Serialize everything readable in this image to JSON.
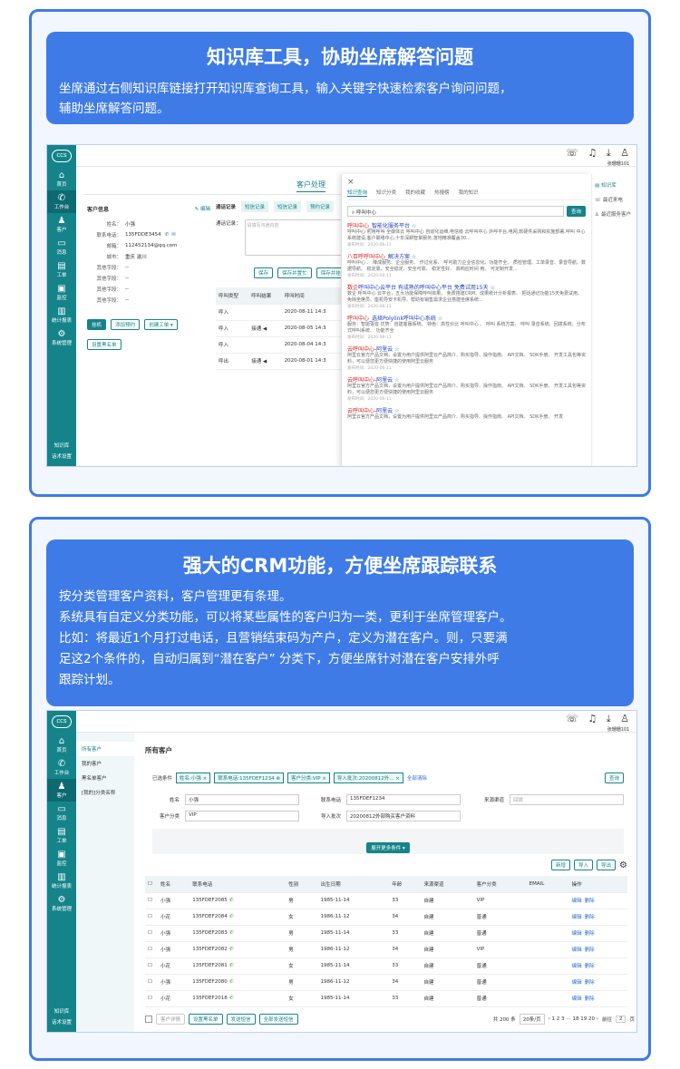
{
  "section1": {
    "title": "知识库工具，协助坐席解答问题",
    "desc_line1": "坐席通过右侧知识库链接打开知识库查询工具，输入关键字快速检索客户询问问题，",
    "desc_line2": "辅助坐席解答问题。",
    "app": {
      "logo": "ccs",
      "nav": [
        {
          "label": "首页",
          "icon": "⌂"
        },
        {
          "label": "工作台",
          "icon": "✆"
        },
        {
          "label": "客户",
          "icon": "♟"
        },
        {
          "label": "消息",
          "icon": "▭"
        },
        {
          "label": "工单",
          "icon": "▤"
        },
        {
          "label": "监控",
          "icon": "▣"
        },
        {
          "label": "统计报表",
          "icon": "▥"
        },
        {
          "label": "系统管理",
          "icon": "⚙"
        }
      ],
      "nav_bottom": [
        "知识库",
        "话术设置"
      ],
      "user": "张珊珊101",
      "tabs": [
        "客户处理",
        "客"
      ],
      "customer": {
        "section_title": "客户信息",
        "edit": "编辑",
        "fields": [
          {
            "k": "姓名：",
            "v": "小强"
          },
          {
            "k": "联系电话：",
            "v": "135FDDE3454"
          },
          {
            "k": "邮箱：",
            "v": "112452134@qq.com"
          },
          {
            "k": "城市：",
            "v": "重庆 渝川"
          },
          {
            "k": "其他字段：",
            "v": "--"
          },
          {
            "k": "其他字段：",
            "v": "--"
          },
          {
            "k": "其他字段：",
            "v": "--"
          },
          {
            "k": "其他字段：",
            "v": "--"
          }
        ],
        "buttons": [
          "挂机",
          "添加预约",
          "创建工单 ▾",
          "设置黑名单"
        ]
      },
      "call": {
        "tabs": [
          "通话记录",
          "短信记录",
          "短信记录",
          "预约记录"
        ],
        "record_label": "通话记录：",
        "placeholder": "请填写沟通内容",
        "buttons": [
          "保存",
          "保存并置忙",
          "保存并挂机"
        ],
        "cols": [
          "呼叫类型",
          "呼叫结果",
          "呼叫时间"
        ],
        "rows": [
          {
            "type": "呼入",
            "result": "",
            "time": "2020-08-11  14:3"
          },
          {
            "type": "呼入",
            "result": "接通 ◀",
            "time": "2020-08-05  14:3"
          },
          {
            "type": "呼入",
            "result": "",
            "time": "2020-08-04  14:3"
          },
          {
            "type": "呼出",
            "result": "接通 ◀",
            "time": "2020-08-01  14:3"
          }
        ]
      },
      "kb": {
        "close": "×",
        "tabs": [
          "知识查询",
          "知识分类",
          "我的收藏",
          "热搜榜",
          "我的知识"
        ],
        "search_value": "呼叫中心",
        "search_btn": "查询",
        "articles": [
          {
            "title_a": "呼叫中心",
            "title_b": "_智能化服务平台",
            "desc": "呼叫中心 利用呼叫 全媒体云 呼叫中心 自动化运维,电信级 云呼叫中心 外呼平台,电网,软硬件采购和实施部署,呼叫 中心系统建设,客户联络中心,十年深耕智掌服务,落地精准覆盖30...",
            "date": "发布时间：2020-06-11"
          },
          {
            "title_a": "八百呼呼叫中心",
            "title_b": "_解决方案",
            "desc": "呼叫中心 、 降成服务、企业服务、 作过化系、 呼可助力企业信息化、功能齐全、 质检管理、工单录音、录音导航、数据导航、 稳定靠、安全稳定、安全可靠、 稳定性好、 高响应时间 用、 可定制开发...",
            "date": "发布时间：2020-06-11"
          },
          {
            "title_a": "数企",
            "title_b": "呼叫中心云平台 有成熟的呼叫中心平台 免费试用15天",
            "desc": "数企 呼叫中心 云平台，五大功能保障呼叫效果。 免费搭建CRM、成果统计分析报表、 把话通记功能15天免费试用、 免除坐席员、座机导安卡机导、帮助有销售需求企业搭建坐席系统...",
            "date": "发布时间：2020-06-11"
          },
          {
            "title_a": "呼叫中心",
            "title_b": "_选择Polylink呼叫中心系统",
            "desc": "服务：智能语音 优势：自建客服系统、 特色：高性价比 呼叫中心 、 呼叫 系统方案、 呼叫 录音系统、回拨系统、分布式呼叫系统、 功能齐全",
            "date": "发布时间：2020-06-11"
          },
          {
            "title_a": "云呼叫中心",
            "title_b": "-阿里云",
            "desc": "阿里云官方产品文档，设置为用户提供阿里云产品简介、购买指导、操作指南、 API文档、 SDK手册、 开发工具包等资料，可以便您更方便快捷的使用阿里云服务",
            "date": "发布时间：2020-06-11"
          },
          {
            "title_a": "云呼叫中心",
            "title_b": "-阿里云",
            "desc": "阿里云官方产品文档，设置为用户提供阿里云产品简介、购买指导、操作指南、 API文档、 SDK手册、 开发工具包等资料，可以便您更方便快捷的使用阿里云服务",
            "date": "发布时间：2020-06-11"
          },
          {
            "title_a": "云呼叫中心",
            "title_b": "-阿里云",
            "desc": "阿里云官方产品文档，设置为用户提供阿里云产品简介、购买指导、操作指南、 API文档、 SDK手册、 开发",
            "date": ""
          }
        ]
      },
      "right_links": [
        "知识库",
        "最近来电",
        "最近服务客户"
      ]
    }
  },
  "section2": {
    "title": "强大的CRM功能，方便坐席跟踪联系",
    "desc_lines": [
      "按分类管理客户资料，客户管理更有条理。",
      "系统具有自定义分类功能，可以将某些属性的客户归为一类，更利于坐席管理客户。",
      "比如：将最近1个月打过电话，且营销结束码为产户，定义为潜在客户。则，只要满",
      "足这2个条件的，自动归属到“潜在客户” 分类下，方便坐席针对潜在客户安排外呼",
      "跟踪计划。"
    ],
    "app": {
      "user": "张珊珊101",
      "subnav": [
        "所有客户",
        "我的客户",
        "黑名单客户",
        "[我的]分类名称"
      ],
      "page_title": "所有客户",
      "filter_label": "已选条件",
      "chips": [
        "姓名:小强 ×",
        "联系电话:135FDEF1234 ⊗",
        "客户分类:VIP ×",
        "导入批次:20200812外... ×"
      ],
      "clear_all": "全部清除",
      "query": "查询",
      "form": {
        "name_label": "姓名",
        "name_value": "小强",
        "phone_label": "联系电话",
        "phone_value": "135FDEF1234",
        "source_label": "来源渠道",
        "source_placeholder": "回拨",
        "cat_label": "客户分类",
        "cat_value": "VIP",
        "batch_label": "导入批次",
        "batch_value": "20200812外部购买客户资料"
      },
      "expand_btn": "展开更多条件 ▾",
      "actions": [
        "新增",
        "导入",
        "导出"
      ],
      "columns": [
        "姓名",
        "联系电话",
        "性别",
        "出生日期",
        "年龄",
        "来源渠道",
        "客户分类",
        "EMAIL",
        "操作"
      ],
      "rows": [
        {
          "name": "小强",
          "phone": "135FDEF2085",
          "gender": "男",
          "birth": "1985-11-14",
          "age": "33",
          "src": "自建",
          "cat": "VIP",
          "email": ""
        },
        {
          "name": "小花",
          "phone": "135FDEF2084",
          "gender": "女",
          "birth": "1986-11-12",
          "age": "34",
          "src": "自建",
          "cat": "普通",
          "email": ""
        },
        {
          "name": "小强",
          "phone": "135FDEF2083",
          "gender": "男",
          "birth": "1985-11-14",
          "age": "33",
          "src": "自建",
          "cat": "普通",
          "email": ""
        },
        {
          "name": "小强",
          "phone": "135FDEF2082",
          "gender": "男",
          "birth": "1986-11-12",
          "age": "34",
          "src": "自建",
          "cat": "VIP",
          "email": ""
        },
        {
          "name": "小花",
          "phone": "135FDEF2081",
          "gender": "女",
          "birth": "1985-11-14",
          "age": "33",
          "src": "自建",
          "cat": "普通",
          "email": ""
        },
        {
          "name": "小强",
          "phone": "135FDEF2080",
          "gender": "男",
          "birth": "1986-11-12",
          "age": "34",
          "src": "自建",
          "cat": "普通",
          "email": ""
        },
        {
          "name": "小花",
          "phone": "135FDEF2018",
          "gender": "女",
          "birth": "1985-11-14",
          "age": "33",
          "src": "自建",
          "cat": "普通",
          "email": ""
        }
      ],
      "op_edit": "编辑",
      "op_del": "删除",
      "footer_btns": [
        "客户详情",
        "设置黑名单",
        "发送短信",
        "全部发送短信"
      ],
      "total": "共 200 条",
      "page_size": "20条/页",
      "pages": "1 2 3 ⋯ 18 19 20",
      "goto_label": "前往",
      "goto_value": "2",
      "goto_unit": "页"
    }
  }
}
